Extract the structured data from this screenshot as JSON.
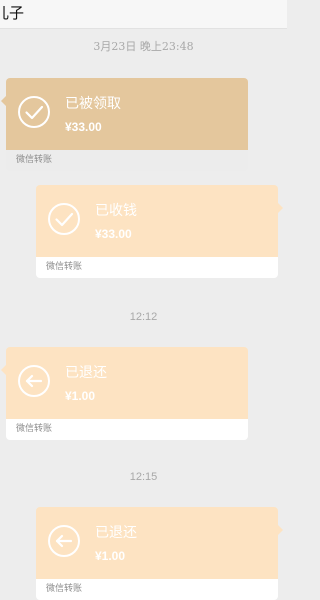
{
  "header": {
    "title": "儿子"
  },
  "timestamps": [
    {
      "text": "3月23日 晚上23:48"
    },
    {
      "text": "12:12"
    },
    {
      "text": "12:15"
    }
  ],
  "cards": [
    {
      "status": "已被领取",
      "amount": "¥33.00",
      "footer": "微信转账"
    },
    {
      "status": "已收钱",
      "amount": "¥33.00",
      "footer": "微信转账"
    },
    {
      "status": "已退还",
      "amount": "¥1.00",
      "footer": "微信转账"
    },
    {
      "status": "已退还",
      "amount": "¥1.00",
      "footer": "微信转账"
    }
  ],
  "colors": {
    "received_top": "#e4c79d",
    "pending_top": "#fde3c2",
    "background": "#ededed"
  },
  "icons": [
    "check-circle-icon",
    "check-circle-icon",
    "arrow-left-circle-icon",
    "arrow-left-circle-icon"
  ]
}
